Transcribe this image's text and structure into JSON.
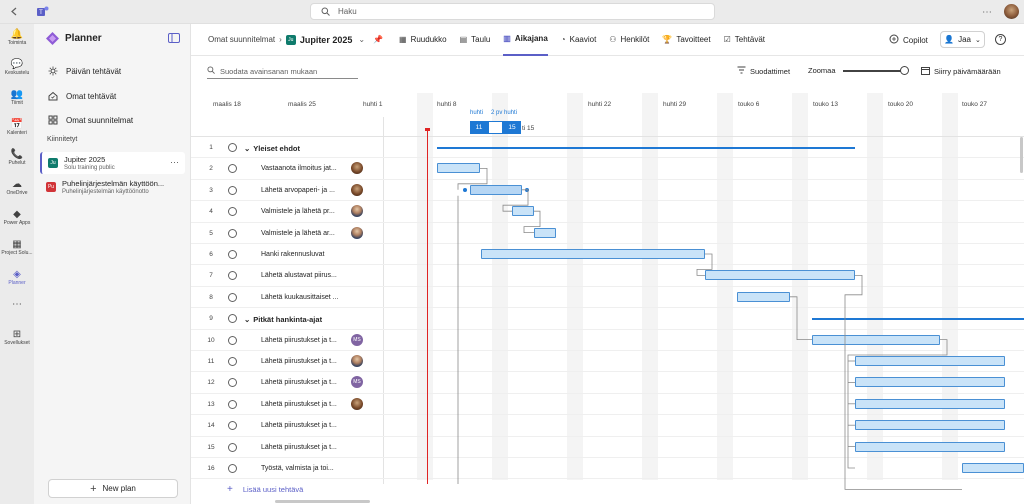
{
  "search_placeholder": "Haku",
  "rail": [
    {
      "label": "Toiminta",
      "icon": "bell-icon"
    },
    {
      "label": "Keskustelu",
      "icon": "chat-icon"
    },
    {
      "label": "Tiimit",
      "icon": "teams-icon"
    },
    {
      "label": "Kalenteri",
      "icon": "calendar-icon"
    },
    {
      "label": "Puhelut",
      "icon": "phone-icon"
    },
    {
      "label": "OneDrive",
      "icon": "cloud-icon"
    },
    {
      "label": "Power Apps",
      "icon": "power-apps-icon"
    },
    {
      "label": "Project Solu...",
      "icon": "project-icon"
    },
    {
      "label": "Planner",
      "icon": "planner-icon"
    },
    {
      "label": "...",
      "icon": "more-icon"
    },
    {
      "label": "Sovellukset",
      "icon": "apps-icon"
    }
  ],
  "sidebar": {
    "title": "Planner",
    "nav": [
      "Päivän tehtävät",
      "Omat tehtävät",
      "Omat suunnitelmat"
    ],
    "pinned_label": "Kiinnitetyt",
    "plans": [
      {
        "name": "Jupiter 2025",
        "sub": "Solu training public",
        "color": "#0f7b6c",
        "letter": "Ju"
      },
      {
        "name": "Puhelinjärjestelmän käyttöön...",
        "sub": "Puhelinjärjestelmän käyttöönotto",
        "color": "#d13438",
        "letter": "Pu"
      }
    ],
    "new_plan": "New plan"
  },
  "header": {
    "breadcrumb": "Omat suunnitelmat",
    "plan": "Jupiter 2025",
    "plan_letter": "Ju",
    "tabs": [
      "Ruudukko",
      "Taulu",
      "Aikajana",
      "Kaaviot",
      "Henkilöt",
      "Tavoitteet",
      "Tehtävät"
    ],
    "active_tab": "Aikajana",
    "copilot": "Copilot",
    "share": "Jaa"
  },
  "filter": {
    "placeholder": "Suodata avainsanan mukaan",
    "filters": "Suodattimet",
    "zoom": "Zoomaa",
    "goto": "Siirry päivämäärään"
  },
  "timeline": {
    "dates": [
      "maalis 18",
      "maalis 25",
      "huhti 1",
      "huhti 8",
      "huhti 15",
      "huhti 22",
      "huhti 29",
      "touko 6",
      "touko 13",
      "touko 20",
      "touko 27"
    ],
    "highlight_label": "huhti",
    "duration_label": "2 pv huhti",
    "day_a": "11",
    "day_b": "15"
  },
  "tasks": [
    {
      "n": "1",
      "name": "Yleiset ehdot",
      "group": true
    },
    {
      "n": "2",
      "name": "Vastaanota ilmoitus jat...",
      "avatar": "photo"
    },
    {
      "n": "3",
      "name": "Lähetä arvopaperi- ja ...",
      "avatar": "photo"
    },
    {
      "n": "4",
      "name": "Valmistele ja lähetä pr...",
      "avatar": "man"
    },
    {
      "n": "5",
      "name": "Valmistele ja lähetä ar...",
      "avatar": "man"
    },
    {
      "n": "6",
      "name": "Hanki rakennusluvat"
    },
    {
      "n": "7",
      "name": "Lähetä alustavat piirus..."
    },
    {
      "n": "8",
      "name": "Lähetä kuukausittaiset ..."
    },
    {
      "n": "9",
      "name": "Pitkät hankinta-ajat",
      "group": true
    },
    {
      "n": "10",
      "name": "Lähetä piirustukset ja t...",
      "avatar": "MS"
    },
    {
      "n": "11",
      "name": "Lähetä piirustukset ja t...",
      "avatar": "man"
    },
    {
      "n": "12",
      "name": "Lähetä piirustukset ja t...",
      "avatar": "MS"
    },
    {
      "n": "13",
      "name": "Lähetä piirustukset ja t...",
      "avatar": "photo"
    },
    {
      "n": "14",
      "name": "Lähetä piirustukset ja t..."
    },
    {
      "n": "15",
      "name": "Lähetä piirustukset ja t..."
    },
    {
      "n": "16",
      "name": "Työstä, valmista ja toi..."
    }
  ],
  "add_task": "Lisää uusi tehtävä",
  "colors": {
    "accent": "#5b5fc7",
    "bar": "#c9e3f8",
    "bar_border": "#4a90d4",
    "summary": "#1e78d4",
    "today": "#e02424"
  }
}
